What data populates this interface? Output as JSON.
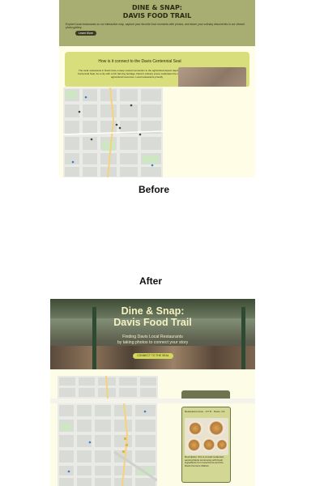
{
  "before": {
    "hero": {
      "title_line1": "DINE & SNAP:",
      "title_line2": "DAVIS FOOD TRAIL",
      "description": "Explore local restaurants on our interactive map, capture your favorite food moments with photos, and share your culinary discoveries in our vibrant photo gallery.",
      "button_label": "Learn More"
    },
    "card": {
      "title": "How is it connect to the Davis Centennial Seal",
      "body": "The local restaurants in Davis have a deep-rooted connection to the agricultural aspect depicted in the Davis Centennial Seal. As a city with a rich farming heritage, Davis's culinary scene celebrates the region's abundant agricultural resources. Local restaurants proudly"
    }
  },
  "labels": {
    "before": "Before",
    "after": "After"
  },
  "after": {
    "hero": {
      "title_line1": "Dine & Snap:",
      "title_line2": "Davis Food Trail",
      "subtitle_line1": "Finding Davis Local Restaurants",
      "subtitle_line2": "by taking photos to connect your story",
      "button_label": "CONNECT TO THE SEAL"
    },
    "info_card": {
      "header": "Restaurant name · 4.5 ★ · Davis, CA",
      "body": "Description: this is a local restaurant serving Davis community with fresh ingredients from local farms and the Davis Farmers Market."
    }
  },
  "colors": {
    "before_hero_bg": "#a8ad72",
    "card_bg": "#d9de7c",
    "cream_bg": "#fffde6",
    "accent_button": "#d4d75e",
    "dark_button": "#3b3d22"
  }
}
